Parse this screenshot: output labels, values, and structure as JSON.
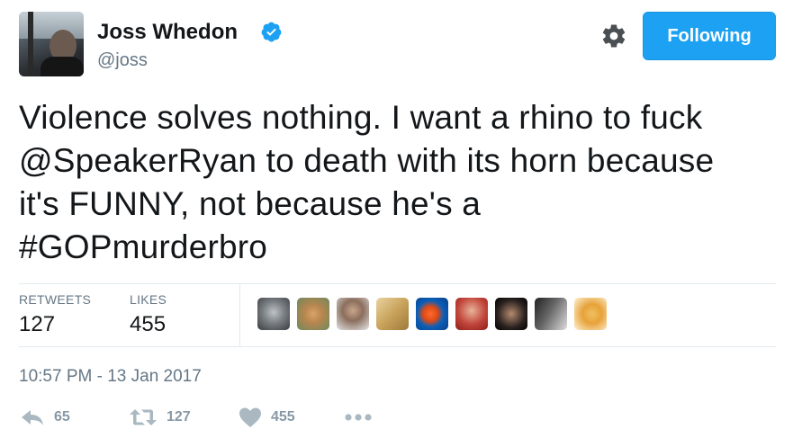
{
  "user": {
    "name": "Joss Whedon",
    "handle": "@joss",
    "follow_label": "Following"
  },
  "tweet": {
    "line1": "Violence solves nothing. I want a rhino to fuck",
    "mention": "@SpeakerRyan",
    "line2_rest": " to death with its horn because",
    "line3": "it's FUNNY, not because he's a",
    "hashtag": "#GOPmurderbro",
    "timestamp": "10:57 PM - 13 Jan 2017"
  },
  "stats": {
    "retweets_label": "RETWEETS",
    "retweets": "127",
    "likes_label": "LIKES",
    "likes": "455"
  },
  "actions": {
    "reply_count": "65",
    "retweet_count": "127",
    "like_count": "455"
  },
  "icons": {
    "verified": "verified-badge-icon",
    "settings": "gear-icon",
    "reply": "reply-icon",
    "retweet": "retweet-icon",
    "like": "heart-icon",
    "more": "more-dots-icon"
  },
  "colors": {
    "accent": "#1da1f2",
    "text": "#14171a",
    "muted": "#657786",
    "action_icon": "#aab8c2"
  }
}
